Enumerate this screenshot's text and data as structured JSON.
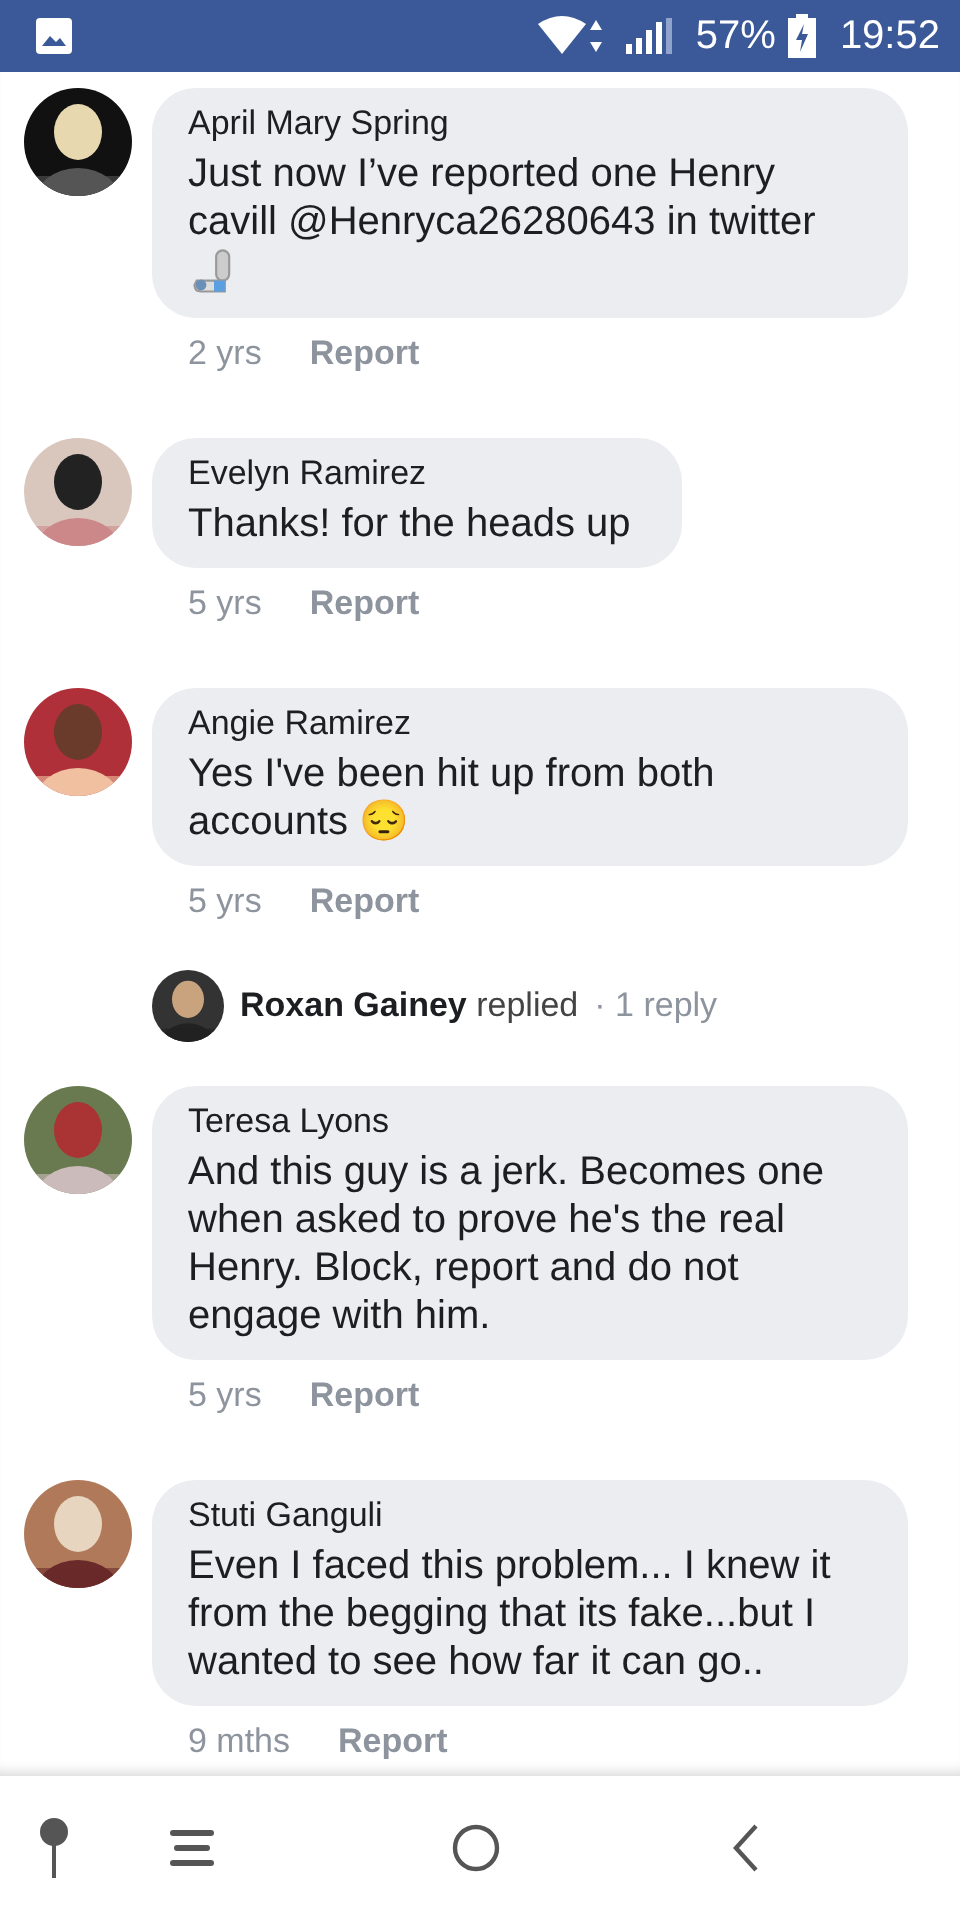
{
  "status_bar": {
    "battery": "57%",
    "time": "19:52"
  },
  "comments": [
    {
      "kind": "comment",
      "author": "April Mary Spring",
      "text": "Just now I’ve reported one Henry cavill @Henryca26280643 in twitter",
      "attachment_icon": true,
      "age": "2 yrs",
      "action": "Report"
    },
    {
      "kind": "comment",
      "author": "Evelyn Ramirez",
      "text": "Thanks! for the heads up",
      "age": "5 yrs",
      "action": "Report"
    },
    {
      "kind": "comment",
      "author": "Angie Ramirez",
      "text": "Yes I've been hit up from both accounts 😔",
      "age": "5 yrs",
      "action": "Report"
    },
    {
      "kind": "reply_summary",
      "text": "**Roxan Gainey** replied",
      "count": "· 1 reply"
    },
    {
      "kind": "comment",
      "author": "Teresa Lyons",
      "text": "And this guy is a jerk. Becomes one when asked to prove he's the real Henry. Block, report and do not engage with him.",
      "age": "5 yrs",
      "action": "Report"
    },
    {
      "kind": "comment",
      "author": "Stuti Ganguli",
      "text": "Even I faced this problem... I knew it from the begging that its fake...but I wanted to see how far it can go..",
      "age": "9 mths",
      "action": "Report"
    }
  ]
}
